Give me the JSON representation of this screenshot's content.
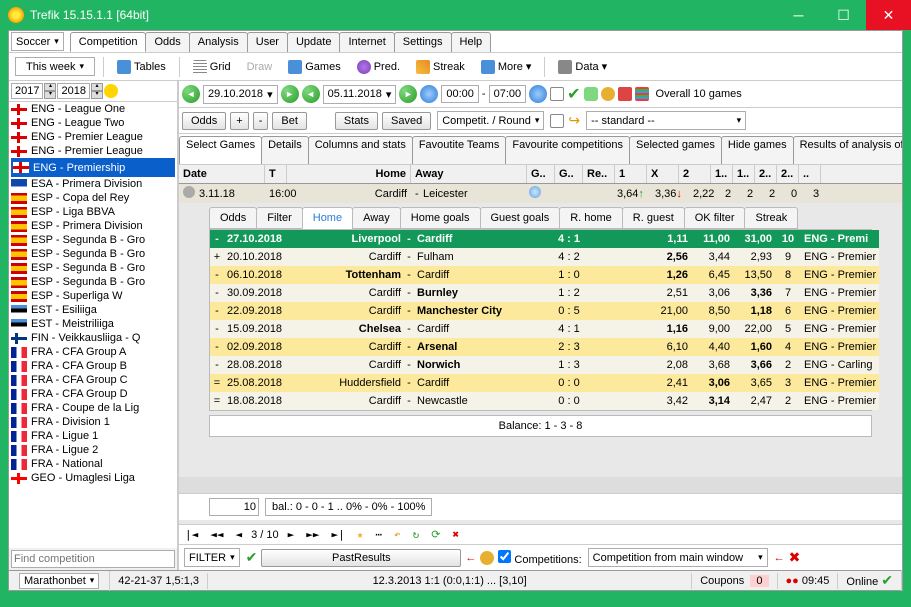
{
  "title": "Trefik 15.15.1.1 [64bit]",
  "topCombo1": "Soccer",
  "topCombo2": "This week",
  "menuTabs": [
    "Competition",
    "Odds",
    "Analysis",
    "User",
    "Update",
    "Internet",
    "Settings",
    "Help"
  ],
  "activeMenu": 0,
  "toolbar": {
    "tables": "Tables",
    "grid": "Grid",
    "draw": "Draw",
    "games": "Games",
    "pred": "Pred.",
    "streak": "Streak",
    "more": "More",
    "data": "Data"
  },
  "yearFrom": "2017",
  "yearTo": "2018",
  "leagues": [
    {
      "flag": "eng",
      "name": "ENG - League One"
    },
    {
      "flag": "eng",
      "name": "ENG - League Two"
    },
    {
      "flag": "eng",
      "name": "ENG - Premier League"
    },
    {
      "flag": "eng",
      "name": "ENG - Premier League"
    },
    {
      "flag": "eng",
      "name": "ENG - Premiership",
      "sel": true
    },
    {
      "flag": "esa",
      "name": "ESA - Primera Division"
    },
    {
      "flag": "esp",
      "name": "ESP - Copa del Rey"
    },
    {
      "flag": "esp",
      "name": "ESP - Liga BBVA"
    },
    {
      "flag": "esp",
      "name": "ESP - Primera Division"
    },
    {
      "flag": "esp",
      "name": "ESP - Segunda B - Gro"
    },
    {
      "flag": "esp",
      "name": "ESP - Segunda B - Gro"
    },
    {
      "flag": "esp",
      "name": "ESP - Segunda B - Gro"
    },
    {
      "flag": "esp",
      "name": "ESP - Segunda B - Gro"
    },
    {
      "flag": "esp",
      "name": "ESP - Superliga W"
    },
    {
      "flag": "est",
      "name": "EST - Esiliiga"
    },
    {
      "flag": "est",
      "name": "EST - Meistriliiga"
    },
    {
      "flag": "fin",
      "name": "FIN - Veikkausliiga - Q"
    },
    {
      "flag": "fra",
      "name": "FRA - CFA Group A"
    },
    {
      "flag": "fra",
      "name": "FRA - CFA Group B"
    },
    {
      "flag": "fra",
      "name": "FRA - CFA Group C"
    },
    {
      "flag": "fra",
      "name": "FRA - CFA Group D"
    },
    {
      "flag": "fra",
      "name": "FRA - Coupe de la Lig"
    },
    {
      "flag": "fra",
      "name": "FRA - Division 1"
    },
    {
      "flag": "fra",
      "name": "FRA - Ligue 1"
    },
    {
      "flag": "fra",
      "name": "FRA - Ligue 2"
    },
    {
      "flag": "fra",
      "name": "FRA - National"
    },
    {
      "flag": "geo",
      "name": "GEO - Umaglesi Liga"
    }
  ],
  "findPlaceholder": "Find competition",
  "dateFrom": "29.10.2018",
  "dateTo": "05.11.2018",
  "timeFrom": "00:00",
  "timeTo": "07:00",
  "overall": "Overall 10 games",
  "btns": {
    "odds": "Odds",
    "plus": "+",
    "minus": "-",
    "bet": "Bet",
    "stats": "Stats",
    "saved": "Saved"
  },
  "roundSel": "Competit. / Round",
  "stdSel": "-- standard --",
  "subtabs": [
    "Select Games",
    "Details",
    "Columns and stats",
    "Favoutite Teams",
    "Favourite competitions",
    "Selected games",
    "Hide games",
    "Results of analysis of"
  ],
  "gh": {
    "date": "Date",
    "t": "T",
    "home": "Home",
    "away": "Away",
    "g": "G..",
    "g2": "G..",
    "re": "Re..",
    "o1": "1",
    "ox": "X",
    "o2": "2",
    "a": "1..",
    "b": "1..",
    "c": "2..",
    "d": "2..",
    "e": ".."
  },
  "fix": {
    "date": "3.11.18",
    "time": "16:00",
    "home": "Cardiff",
    "away": "Leicester",
    "o1": "3,64",
    "ox": "3,36",
    "o2": "2,22",
    "a": "2",
    "b": "2",
    "c": "2",
    "d": "0",
    "e": "3"
  },
  "innertabs": [
    "Odds",
    "Filter",
    "Home",
    "Away",
    "Home goals",
    "Guest goals",
    "R. home",
    "R. guest",
    "OK filter",
    "Streak"
  ],
  "matches": [
    {
      "cls": "hdr",
      "pm": "-",
      "date": "27.10.2018",
      "home": "Liverpool",
      "away": "Cardiff",
      "score": "4 : 1",
      "o1": "1,11",
      "ox": "11,00",
      "o2": "31,00",
      "r": "10",
      "lg": "ENG - Premi"
    },
    {
      "cls": "plain",
      "pm": "+",
      "date": "20.10.2018",
      "home": "Cardiff",
      "away": "Fulham",
      "score": "4 : 2",
      "o1": "2,56",
      "o1b": true,
      "ox": "3,44",
      "o2": "2,93",
      "r": "9",
      "lg": "ENG - Premier"
    },
    {
      "cls": "yel",
      "pm": "-",
      "date": "06.10.2018",
      "home": "Tottenham",
      "homeb": true,
      "away": "Cardiff",
      "score": "1 : 0",
      "o1": "1,26",
      "o1b": true,
      "ox": "6,45",
      "o2": "13,50",
      "r": "8",
      "lg": "ENG - Premier"
    },
    {
      "cls": "plain",
      "pm": "-",
      "date": "30.09.2018",
      "home": "Cardiff",
      "away": "Burnley",
      "awayb": true,
      "score": "1 : 2",
      "o1": "2,51",
      "ox": "3,06",
      "o2": "3,36",
      "o2b": true,
      "r": "7",
      "lg": "ENG - Premier"
    },
    {
      "cls": "yel",
      "pm": "-",
      "date": "22.09.2018",
      "home": "Cardiff",
      "away": "Manchester City",
      "awayb": true,
      "score": "0 : 5",
      "o1": "21,00",
      "ox": "8,50",
      "o2": "1,18",
      "o2b": true,
      "r": "6",
      "lg": "ENG - Premier"
    },
    {
      "cls": "plain",
      "pm": "-",
      "date": "15.09.2018",
      "home": "Chelsea",
      "homeb": true,
      "away": "Cardiff",
      "score": "4 : 1",
      "o1": "1,16",
      "o1b": true,
      "ox": "9,00",
      "o2": "22,00",
      "r": "5",
      "lg": "ENG - Premier"
    },
    {
      "cls": "yel",
      "pm": "-",
      "date": "02.09.2018",
      "home": "Cardiff",
      "away": "Arsenal",
      "awayb": true,
      "score": "2 : 3",
      "o1": "6,10",
      "ox": "4,40",
      "o2": "1,60",
      "o2b": true,
      "r": "4",
      "lg": "ENG - Premier"
    },
    {
      "cls": "plain",
      "pm": "-",
      "date": "28.08.2018",
      "home": "Cardiff",
      "away": "Norwich",
      "awayb": true,
      "score": "1 : 3",
      "o1": "2,08",
      "ox": "3,68",
      "o2": "3,66",
      "o2b": true,
      "r": "2",
      "lg": "ENG - Carling"
    },
    {
      "cls": "yel",
      "pm": "=",
      "date": "25.08.2018",
      "home": "Huddersfield",
      "away": "Cardiff",
      "score": "0 : 0",
      "o1": "2,41",
      "ox": "3,06",
      "oxb": true,
      "o2": "3,65",
      "r": "3",
      "lg": "ENG - Premier"
    },
    {
      "cls": "plain",
      "pm": "=",
      "date": "18.08.2018",
      "home": "Cardiff",
      "away": "Newcastle",
      "score": "0 : 0",
      "o1": "3,42",
      "ox": "3,14",
      "oxb": true,
      "o2": "2,47",
      "r": "2",
      "lg": "ENG - Premier"
    }
  ],
  "balance": "Balance: 1 - 3 - 8",
  "balInput": "10",
  "balText": "bal.: 0 - 0 - 1 .. 0% - 0% - 100%",
  "pager": "3 / 10",
  "filter": "FILTER",
  "pastResults": "PastResults",
  "compLabel": "Competitions:",
  "compSel": "Competition from main window",
  "status": {
    "book": "Marathonbet",
    "rec": "42-21-37  1,5:1,3",
    "hist": "12.3.2013 1:1 (0:0,1:1) ... [3,10]",
    "coupons": "Coupons",
    "c": "0",
    "time": "09:45",
    "online": "Online"
  }
}
